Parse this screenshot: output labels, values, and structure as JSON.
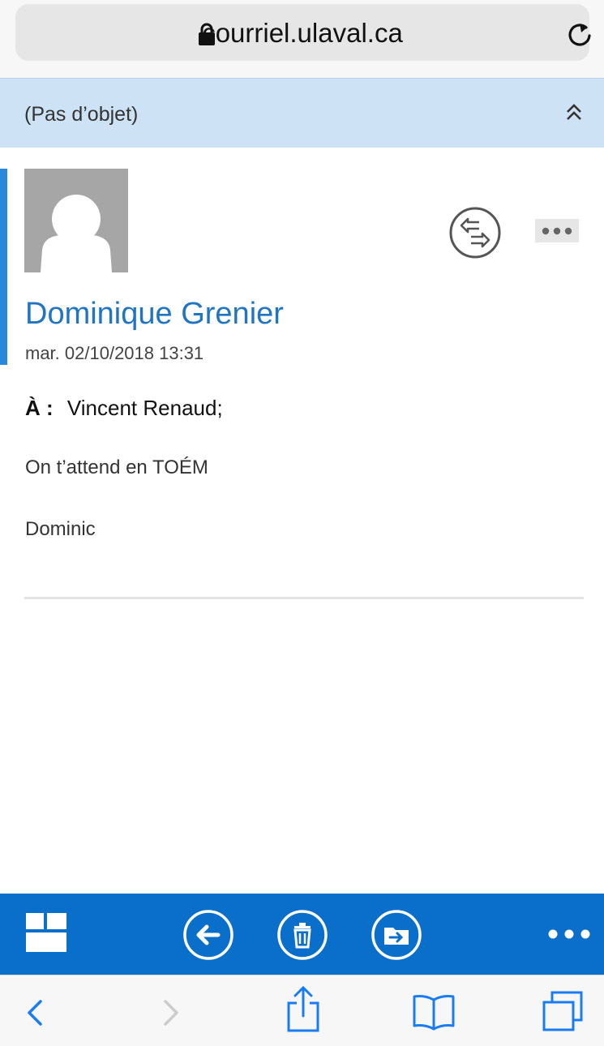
{
  "browser": {
    "url": "courriel.ulaval.ca",
    "icons": {
      "lock": "lock-icon",
      "reload": "reload-icon"
    }
  },
  "message": {
    "subject": "(Pas d’objet)",
    "sender": "Dominique Grenier",
    "date": "mar. 02/10/2018 13:31",
    "to_label": "À :",
    "to_value": "Vincent Renaud;",
    "body": [
      "On t’attend en TOÉM",
      "Dominic"
    ],
    "icons": {
      "avatar": "person-placeholder-icon",
      "reply_all": "reply-all-icon",
      "more": "more-dots-icon"
    }
  },
  "toolbar": {
    "icons": [
      "grid-icon",
      "back-arrow-icon",
      "trash-icon",
      "move-folder-icon",
      "more-dots-icon"
    ]
  },
  "safari_toolbar": {
    "icons": [
      "chevron-left-icon",
      "chevron-right-icon",
      "share-icon",
      "bookmarks-icon",
      "tabs-icon"
    ]
  },
  "colors": {
    "accent": "#1f74c4",
    "toolbar": "#0a6fcb",
    "subject_bar": "#cde3f5",
    "selection": "#2b88d8"
  }
}
